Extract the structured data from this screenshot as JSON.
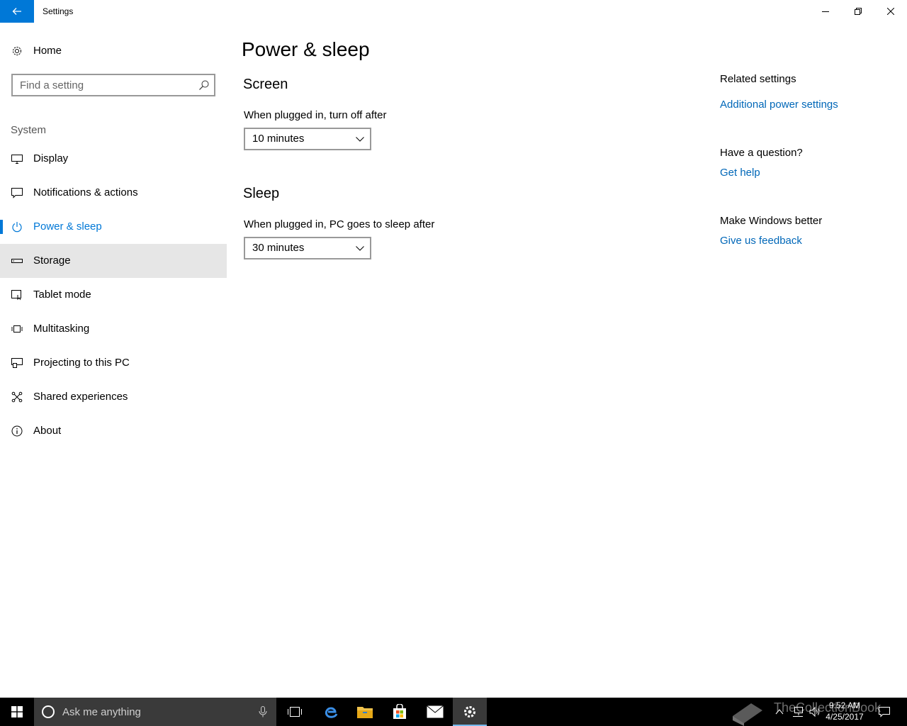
{
  "window": {
    "title": "Settings",
    "back_icon": "back-arrow-icon",
    "controls": [
      "minimize-icon",
      "restore-icon",
      "close-icon"
    ]
  },
  "sidebar": {
    "home_label": "Home",
    "search_placeholder": "Find a setting",
    "group_label": "System",
    "items": [
      {
        "label": "Display",
        "icon": "monitor-icon"
      },
      {
        "label": "Notifications & actions",
        "icon": "message-icon"
      },
      {
        "label": "Power & sleep",
        "icon": "power-icon",
        "active": true
      },
      {
        "label": "Storage",
        "icon": "storage-drive-icon",
        "hover": true
      },
      {
        "label": "Tablet mode",
        "icon": "tablet-mode-icon"
      },
      {
        "label": "Multitasking",
        "icon": "multitasking-icon"
      },
      {
        "label": "Projecting to this PC",
        "icon": "projecting-icon"
      },
      {
        "label": "Shared experiences",
        "icon": "shared-experiences-icon"
      },
      {
        "label": "About",
        "icon": "info-icon"
      }
    ]
  },
  "main": {
    "title": "Power & sleep",
    "screen": {
      "heading": "Screen",
      "label": "When plugged in, turn off after",
      "value": "10 minutes"
    },
    "sleep": {
      "heading": "Sleep",
      "label": "When plugged in, PC goes to sleep after",
      "value": "30 minutes"
    }
  },
  "related": {
    "heading": "Related settings",
    "link": "Additional power settings",
    "question_heading": "Have a question?",
    "help_link": "Get help",
    "better_heading": "Make Windows better",
    "feedback_link": "Give us feedback"
  },
  "taskbar": {
    "search_text": "Ask me anything",
    "time": "9:52 AM",
    "date": "4/25/2017",
    "watermark": "TheCollectionBook",
    "colors": {
      "accent": "#0078d7",
      "link": "#0067b8",
      "taskbar": "#000000"
    }
  }
}
